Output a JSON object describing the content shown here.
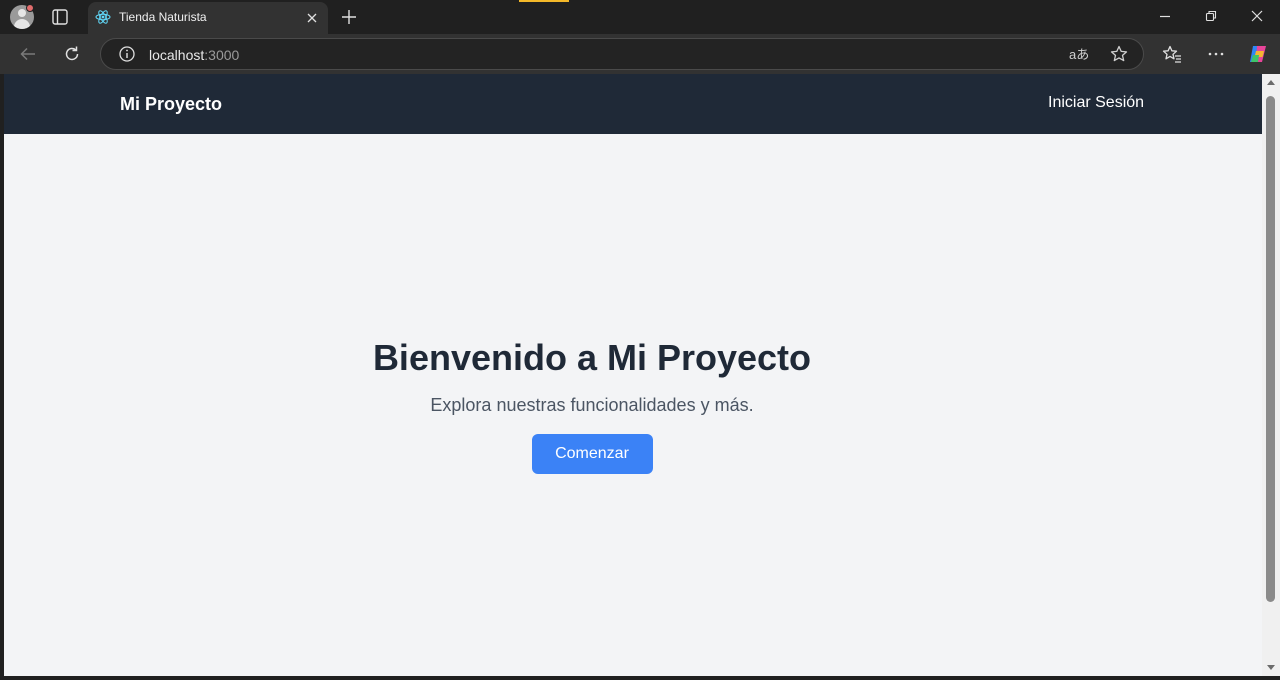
{
  "browser": {
    "tab": {
      "title": "Tienda Naturista",
      "favicon": "react-icon"
    },
    "address": {
      "host": "localhost",
      "port": ":3000"
    },
    "icons": [
      "profile-icon",
      "tab-actions-icon",
      "close-icon",
      "plus-icon",
      "minimize-icon",
      "restore-icon",
      "window-close-icon",
      "back-arrow-icon",
      "reload-icon",
      "info-icon",
      "translate-icon",
      "star-icon",
      "favorites-icon",
      "more-icon",
      "copilot-icon"
    ],
    "translate_glyph": "aあ"
  },
  "page": {
    "navbar": {
      "brand": "Mi Proyecto",
      "login": "Iniciar Sesión",
      "background": "#1f2937"
    },
    "hero": {
      "title": "Bienvenido a Mi Proyecto",
      "subtitle": "Explora nuestras funcionalidades y más.",
      "button": "Comenzar"
    },
    "colors": {
      "accent": "#3b82f6",
      "page_background": "#f3f4f6"
    }
  }
}
